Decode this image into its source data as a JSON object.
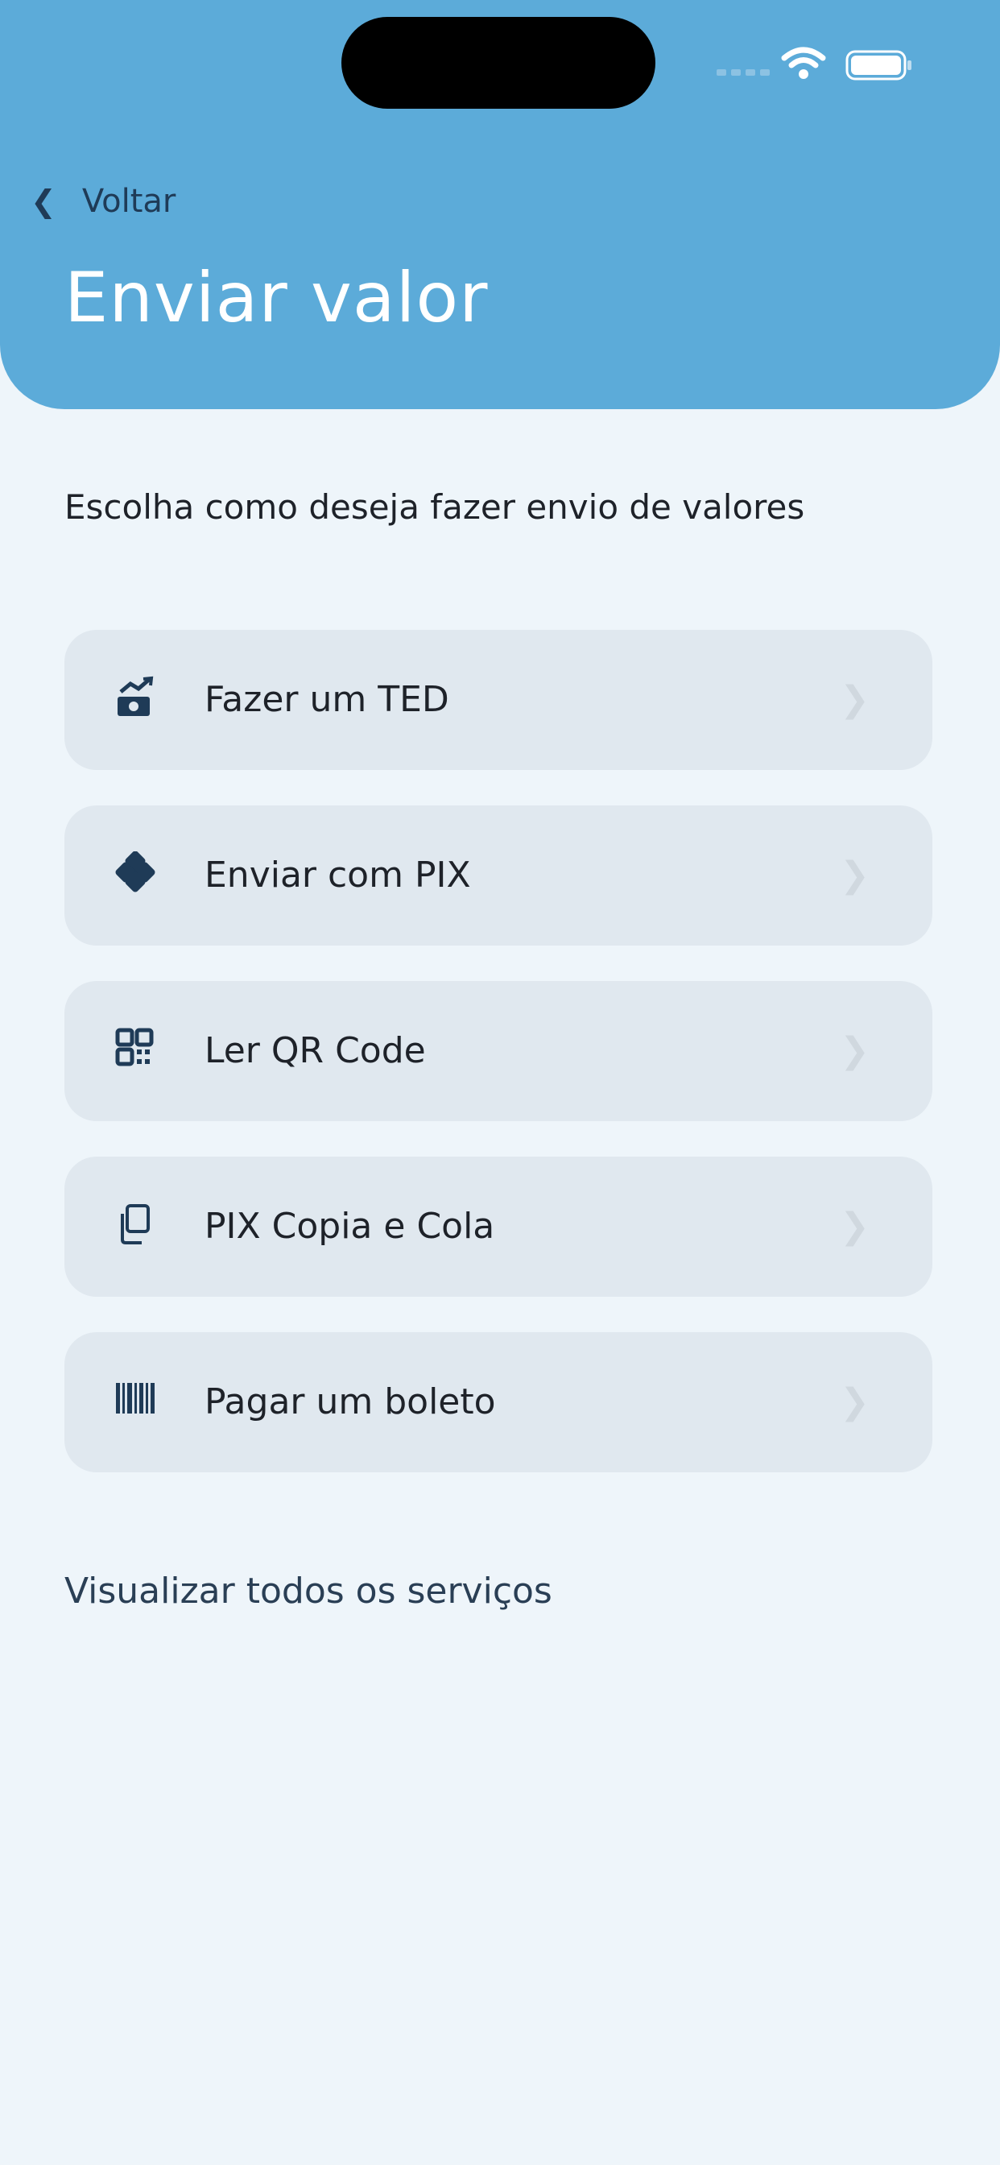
{
  "header": {
    "back_label": "Voltar",
    "title": "Enviar valor"
  },
  "subtitle": "Escolha como deseja fazer envio de valores",
  "options": [
    {
      "label": "Fazer um TED",
      "icon": "money-transfer-icon"
    },
    {
      "label": "Enviar com PIX",
      "icon": "pix-icon"
    },
    {
      "label": "Ler QR Code",
      "icon": "qr-code-icon"
    },
    {
      "label": "PIX Copia e Cola",
      "icon": "copy-icon"
    },
    {
      "label": "Pagar um boleto",
      "icon": "barcode-icon"
    }
  ],
  "view_all": "Visualizar todos os serviços",
  "colors": {
    "header": "#5cabd9",
    "background": "#eef5fa",
    "card": "#e0e8ef",
    "icon": "#1f3b57"
  }
}
